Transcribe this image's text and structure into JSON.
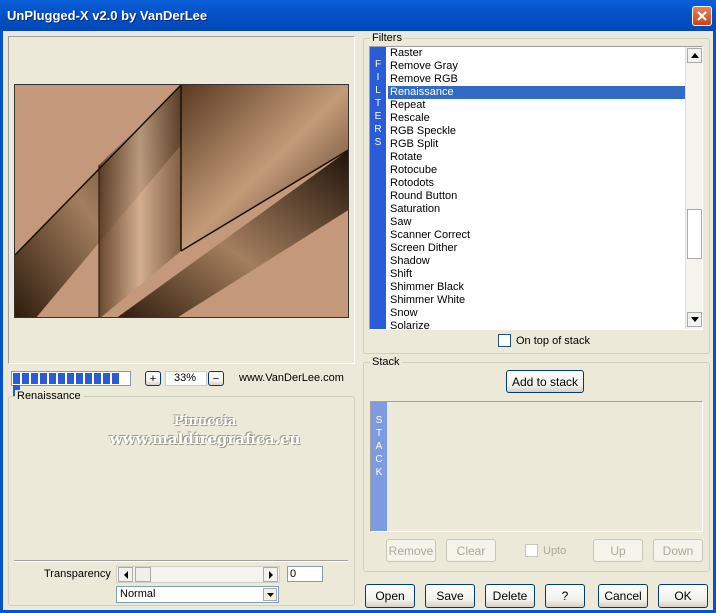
{
  "window": {
    "title": "UnPlugged-X v2.0 by VanDerLee"
  },
  "filters": {
    "group_label": "Filters",
    "strip_letters": [
      "F",
      "I",
      "L",
      "T",
      "E",
      "R",
      "S"
    ],
    "items": [
      "Raster",
      "Remove Gray",
      "Remove RGB",
      "Renaissance",
      "Repeat",
      "Rescale",
      "RGB Speckle",
      "RGB Split",
      "Rotate",
      "Rotocube",
      "Rotodots",
      "Round Button",
      "Saturation",
      "Saw",
      "Scanner Correct",
      "Screen Dither",
      "Shadow",
      "Shift",
      "Shimmer Black",
      "Shimmer White",
      "Snow",
      "Solarize"
    ],
    "selected": "Renaissance",
    "on_top_label": "On top of stack"
  },
  "preview": {
    "zoom": "33%",
    "zoom_in": "+",
    "zoom_out": "−",
    "website": "www.VanDerLee.com",
    "progress_blocks": 13
  },
  "settings": {
    "group_label": "Renaissance",
    "watermark_line1": "Pinuccia",
    "watermark_line2": "www.maldiregrafica.eu",
    "transparency_label": "Transparency",
    "transparency_value": "0",
    "blend_mode": "Normal"
  },
  "stack": {
    "group_label": "Stack",
    "add_label": "Add to stack",
    "strip_letters": [
      "S",
      "T",
      "A",
      "C",
      "K"
    ],
    "remove_label": "Remove",
    "clear_label": "Clear",
    "upto_label": "Upto",
    "up_label": "Up",
    "down_label": "Down"
  },
  "bottom": {
    "open": "Open",
    "save": "Save",
    "delete": "Delete",
    "help": "?",
    "cancel": "Cancel",
    "ok": "OK"
  },
  "colors": {
    "selection": "#316ac5",
    "strip_blue": "#2a5cd8",
    "strip_light": "#7f9be0",
    "titlebar": "#0453c8"
  }
}
